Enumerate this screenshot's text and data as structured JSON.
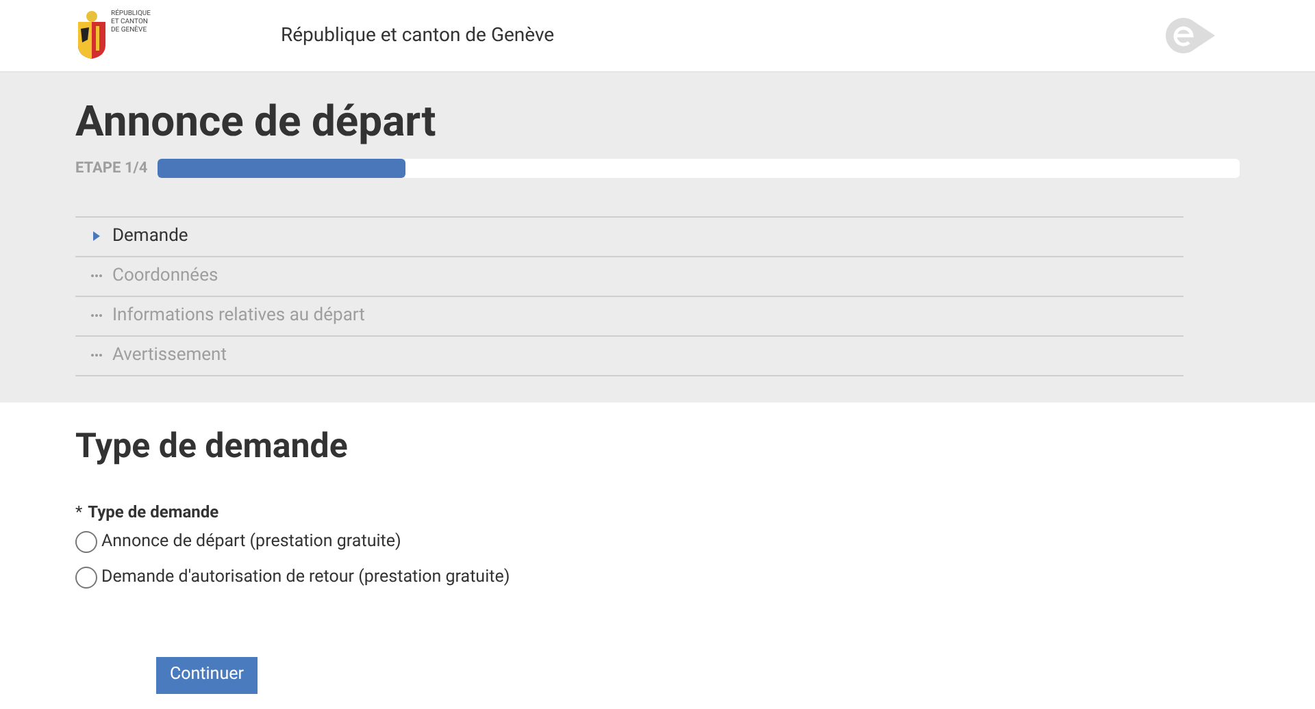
{
  "header": {
    "logo_text": [
      "RÉPUBLIQUE",
      "ET CANTON",
      "DE GENÈVE"
    ],
    "title": "République et canton de Genève"
  },
  "page": {
    "title": "Annonce de départ",
    "step_label": "ETAPE 1/4",
    "progress": {
      "level": 0.23
    }
  },
  "steps": [
    {
      "label": "Demande",
      "selected": true
    },
    {
      "label": "Coordonnées",
      "selected": false
    },
    {
      "label": "Informations relatives au départ",
      "selected": false
    },
    {
      "label": "Avertissement",
      "selected": false
    }
  ],
  "form": {
    "title": "Type de demande",
    "field": {
      "required_mark": "*",
      "label": "Type de demande"
    },
    "options": [
      {
        "label": "Annonce de départ (prestation gratuite)",
        "selected": false
      },
      {
        "label": "Demande d'autorisation de retour (prestation gratuite)",
        "selected": false
      }
    ],
    "submit": "Continuer"
  }
}
